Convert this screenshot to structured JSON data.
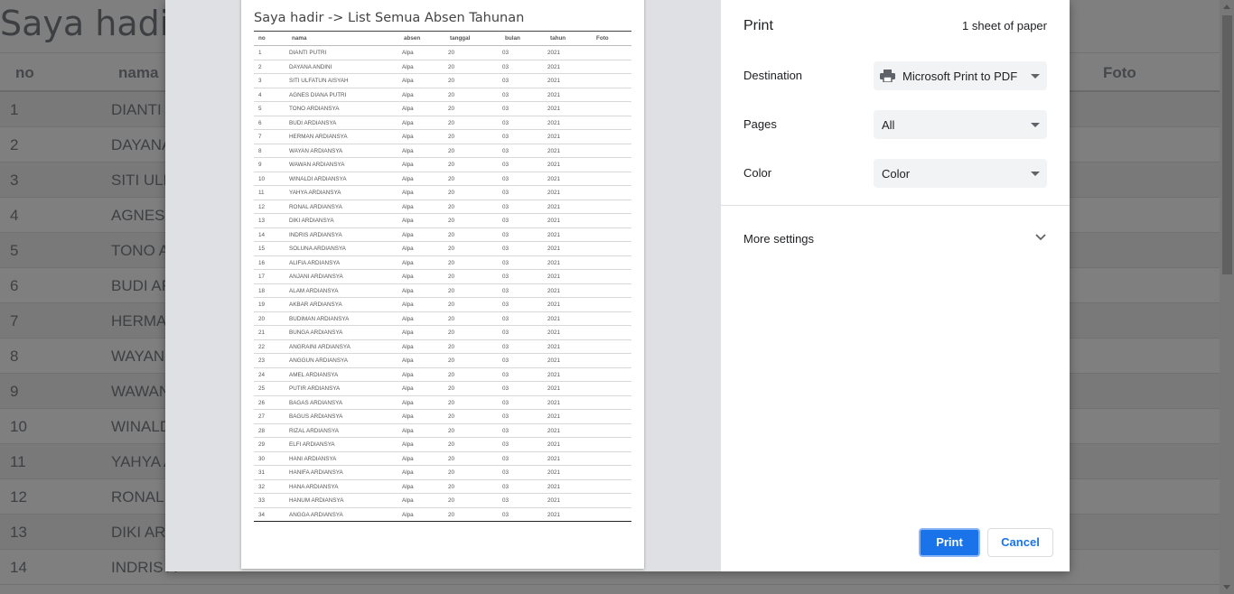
{
  "background": {
    "title": "Saya hadir",
    "headers": {
      "no": "no",
      "nama": "nama",
      "foto": "Foto"
    },
    "rows": [
      {
        "no": "1",
        "nama": "DIANTI I"
      },
      {
        "no": "2",
        "nama": "DAYANA"
      },
      {
        "no": "3",
        "nama": "SITI ULF"
      },
      {
        "no": "4",
        "nama": "AGNES I"
      },
      {
        "no": "5",
        "nama": "TONO A"
      },
      {
        "no": "6",
        "nama": "BUDI AF"
      },
      {
        "no": "7",
        "nama": "HERMAI"
      },
      {
        "no": "8",
        "nama": "WAYAN"
      },
      {
        "no": "9",
        "nama": "WAWAN"
      },
      {
        "no": "10",
        "nama": "WINALD"
      },
      {
        "no": "11",
        "nama": "YAHYA A"
      },
      {
        "no": "12",
        "nama": "RONAL"
      },
      {
        "no": "13",
        "nama": "DIKI ARI"
      },
      {
        "no": "14",
        "nama": "INDRIS A"
      }
    ]
  },
  "preview": {
    "title": "Saya hadir -> List Semua Absen Tahunan",
    "columns": [
      "no",
      "nama",
      "absen",
      "tanggal",
      "bulan",
      "tahun",
      "Foto"
    ],
    "rows": [
      [
        "1",
        "DIANTI PUTRI",
        "Alpa",
        "20",
        "03",
        "2021"
      ],
      [
        "2",
        "DAYANA ANDINI",
        "Alpa",
        "20",
        "03",
        "2021"
      ],
      [
        "3",
        "SITI ULFATUN AISYAH",
        "Alpa",
        "20",
        "03",
        "2021"
      ],
      [
        "4",
        "AGNES DIANA PUTRI",
        "Alpa",
        "20",
        "03",
        "2021"
      ],
      [
        "5",
        "TONO ARDIANSYA",
        "Alpa",
        "20",
        "03",
        "2021"
      ],
      [
        "6",
        "BUDI ARDIANSYA",
        "Alpa",
        "20",
        "03",
        "2021"
      ],
      [
        "7",
        "HERMAN ARDIANSYA",
        "Alpa",
        "20",
        "03",
        "2021"
      ],
      [
        "8",
        "WAYAN ARDIANSYA",
        "Alpa",
        "20",
        "03",
        "2021"
      ],
      [
        "9",
        "WAWAN ARDIANSYA",
        "Alpa",
        "20",
        "03",
        "2021"
      ],
      [
        "10",
        "WINALDI ARDIANSYA",
        "Alpa",
        "20",
        "03",
        "2021"
      ],
      [
        "11",
        "YAHYA ARDIANSYA",
        "Alpa",
        "20",
        "03",
        "2021"
      ],
      [
        "12",
        "RONAL ARDIANSYA",
        "Alpa",
        "20",
        "03",
        "2021"
      ],
      [
        "13",
        "DIKI ARDIANSYA",
        "Alpa",
        "20",
        "03",
        "2021"
      ],
      [
        "14",
        "INDRIS ARDIANSYA",
        "Alpa",
        "20",
        "03",
        "2021"
      ],
      [
        "15",
        "SOLUNA ARDIANSYA",
        "Alpa",
        "20",
        "03",
        "2021"
      ],
      [
        "16",
        "ALIFIA ARDIANSYA",
        "Alpa",
        "20",
        "03",
        "2021"
      ],
      [
        "17",
        "ANJANI ARDIANSYA",
        "Alpa",
        "20",
        "03",
        "2021"
      ],
      [
        "18",
        "ALAM ARDIANSYA",
        "Alpa",
        "20",
        "03",
        "2021"
      ],
      [
        "19",
        "AKBAR ARDIANSYA",
        "Alpa",
        "20",
        "03",
        "2021"
      ],
      [
        "20",
        "BUDIMAN ARDIANSYA",
        "Alpa",
        "20",
        "03",
        "2021"
      ],
      [
        "21",
        "BUNGA ARDIANSYA",
        "Alpa",
        "20",
        "03",
        "2021"
      ],
      [
        "22",
        "ANGRAINI ARDIANSYA",
        "Alpa",
        "20",
        "03",
        "2021"
      ],
      [
        "23",
        "ANGGUN ARDIANSYA",
        "Alpa",
        "20",
        "03",
        "2021"
      ],
      [
        "24",
        "AMEL ARDIANSYA",
        "Alpa",
        "20",
        "03",
        "2021"
      ],
      [
        "25",
        "PUTIR ARDIANSYA",
        "Alpa",
        "20",
        "03",
        "2021"
      ],
      [
        "26",
        "BAGAS ARDIANSYA",
        "Alpa",
        "20",
        "03",
        "2021"
      ],
      [
        "27",
        "BAGUS ARDIANSYA",
        "Alpa",
        "20",
        "03",
        "2021"
      ],
      [
        "28",
        "RIZAL ARDIANSYA",
        "Alpa",
        "20",
        "03",
        "2021"
      ],
      [
        "29",
        "ELFI ARDIANSYA",
        "Alpa",
        "20",
        "03",
        "2021"
      ],
      [
        "30",
        "HANI ARDIANSYA",
        "Alpa",
        "20",
        "03",
        "2021"
      ],
      [
        "31",
        "HANIFA ARDIANSYA",
        "Alpa",
        "20",
        "03",
        "2021"
      ],
      [
        "32",
        "HANA ARDIANSYA",
        "Alpa",
        "20",
        "03",
        "2021"
      ],
      [
        "33",
        "HANUM ARDIANSYA",
        "Alpa",
        "20",
        "03",
        "2021"
      ],
      [
        "34",
        "ANGGA ARDIANSYA",
        "Alpa",
        "20",
        "03",
        "2021"
      ]
    ]
  },
  "print": {
    "title": "Print",
    "sheets": "1 sheet of paper",
    "destination_label": "Destination",
    "destination_value": "Microsoft Print to PDF",
    "destination_icon": "printer-icon",
    "pages_label": "Pages",
    "pages_value": "All",
    "color_label": "Color",
    "color_value": "Color",
    "more_settings": "More settings",
    "print_button": "Print",
    "cancel_button": "Cancel",
    "accent_color": "#1a73e8"
  }
}
